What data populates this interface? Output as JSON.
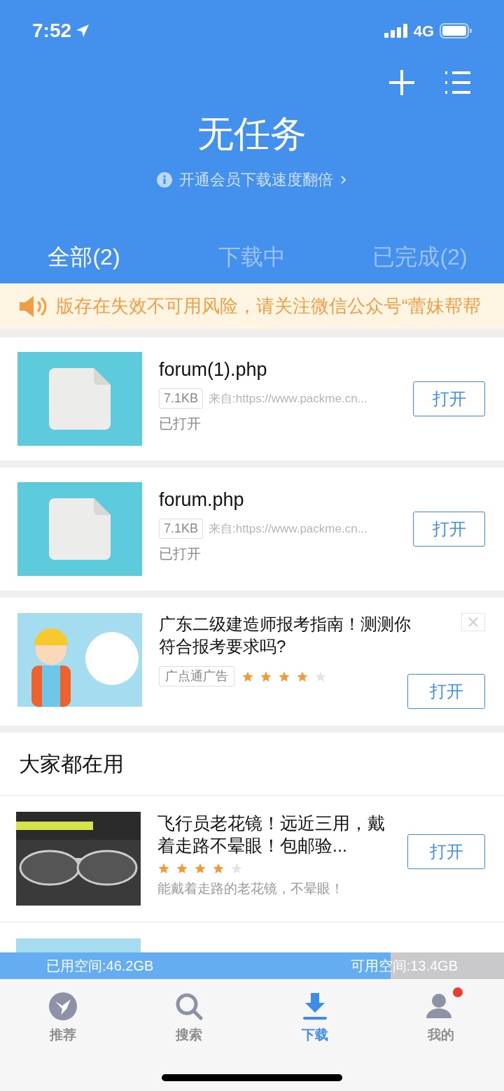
{
  "status_bar": {
    "time": "7:52",
    "network": "4G"
  },
  "header": {
    "title": "无任务",
    "promo": "开通会员下载速度翻倍"
  },
  "tabs": [
    {
      "label": "全部(2)",
      "selected": true
    },
    {
      "label": "下载中",
      "selected": false
    },
    {
      "label": "已完成(2)",
      "selected": false
    }
  ],
  "notice": "版存在失效不可用风险，请关注微信公众号“蕾妹帮帮",
  "downloads": [
    {
      "kind": "file",
      "name": "forum(1).php",
      "size": "7.1KB",
      "source": "来自:https://www.packme.cn...",
      "status": "已打开",
      "button": "打开"
    },
    {
      "kind": "file",
      "name": "forum.php",
      "size": "7.1KB",
      "source": "来自:https://www.packme.cn...",
      "status": "已打开",
      "button": "打开"
    },
    {
      "kind": "ad",
      "name": "广东二级建造师报考指南！测测你符合报考要求吗?",
      "tag": "广点通广告",
      "stars": 4,
      "button": "打开"
    }
  ],
  "recommended": {
    "title": "大家都在用",
    "items": [
      {
        "kind": "app",
        "name": "飞行员老花镜！远近三用，戴着走路不晕眼！包邮验...",
        "stars": 4,
        "description": "能戴着走路的老花镜，不晕眼！",
        "button": "打开"
      },
      {
        "kind": "cut_off"
      }
    ]
  },
  "storage": {
    "used": "已用空间:46.2GB",
    "free": "可用空间:13.4GB",
    "level": 0.775
  },
  "nav": [
    {
      "label": "推荐",
      "selected": false,
      "dot": false
    },
    {
      "label": "搜索",
      "selected": false,
      "dot": false
    },
    {
      "label": "下载",
      "selected": true,
      "dot": false
    },
    {
      "label": "我的",
      "selected": false,
      "dot": true
    }
  ]
}
